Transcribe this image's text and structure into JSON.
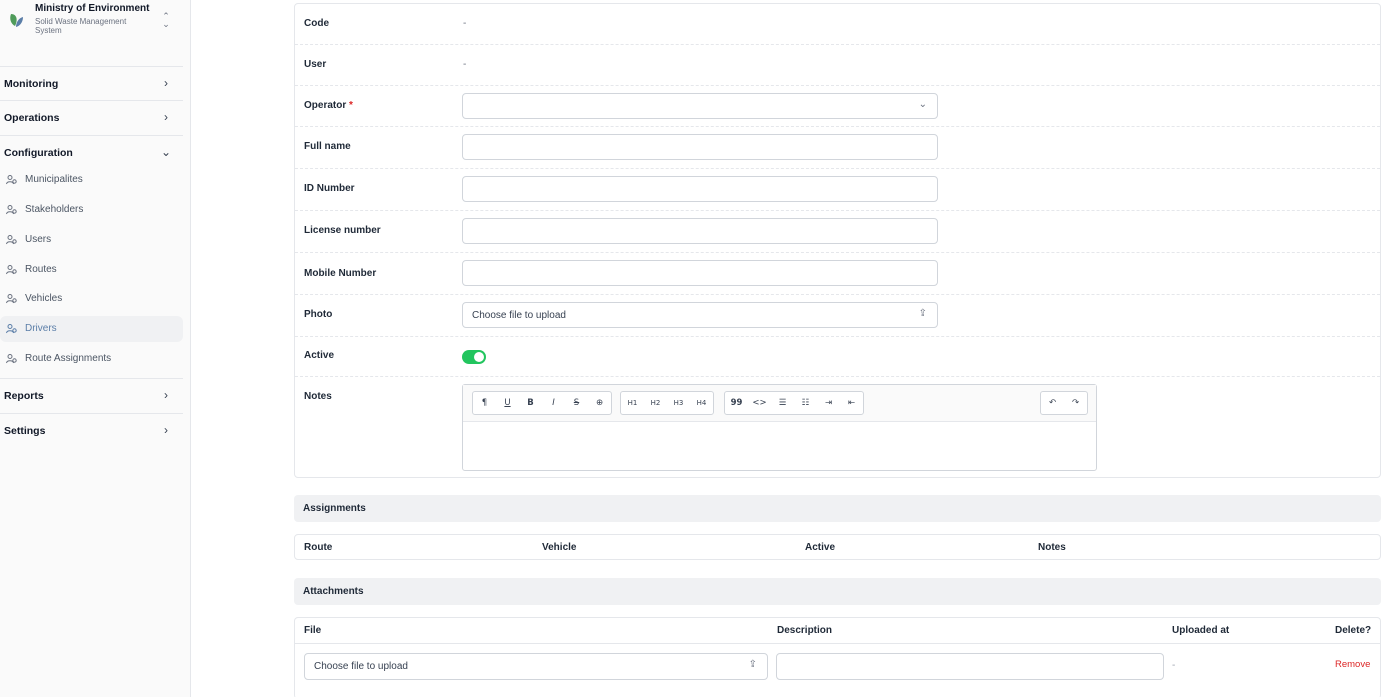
{
  "brand": {
    "title": "Ministry of Environment",
    "subtitle": "Solid Waste Management System",
    "toggle_icon": "chevron-up-down-icon",
    "logo_colors": [
      "#4f9b5a",
      "#5b7ea8"
    ]
  },
  "sidebar": {
    "monitoring": "Monitoring",
    "operations": "Operations",
    "configuration": "Configuration",
    "reports": "Reports",
    "settings": "Settings",
    "items": [
      {
        "label": "Municipalites"
      },
      {
        "label": "Stakeholders"
      },
      {
        "label": "Users"
      },
      {
        "label": "Routes"
      },
      {
        "label": "Vehicles"
      },
      {
        "label": "Drivers",
        "active": true
      },
      {
        "label": "Route Assignments"
      }
    ],
    "active_color": "#5b7ea8"
  },
  "form": {
    "code": {
      "label": "Code",
      "value": "-"
    },
    "user": {
      "label": "User",
      "value": "-"
    },
    "operator": {
      "label": "Operator",
      "required": "*",
      "value": ""
    },
    "full_name": {
      "label": "Full name",
      "value": ""
    },
    "id_number": {
      "label": "ID Number",
      "value": ""
    },
    "license_number": {
      "label": "License number",
      "value": ""
    },
    "mobile_number": {
      "label": "Mobile Number",
      "value": ""
    },
    "photo": {
      "label": "Photo",
      "placeholder": "Choose file to upload"
    },
    "active": {
      "label": "Active",
      "checked": true,
      "color": "#22c55e"
    },
    "notes": {
      "label": "Notes",
      "toolbar": [
        [
          "¶",
          "U",
          "B",
          "I",
          "S",
          "⊕"
        ],
        [
          "H1",
          "H2",
          "H3",
          "H4"
        ],
        [
          "99",
          "<>",
          "☰",
          "☷",
          "⇥",
          "⇤"
        ],
        [
          "↶",
          "↷"
        ]
      ]
    }
  },
  "assignments": {
    "title": "Assignments",
    "columns": [
      "Route",
      "Vehicle",
      "Active",
      "Notes"
    ]
  },
  "attachments": {
    "title": "Attachments",
    "columns": [
      "File",
      "Description",
      "Uploaded at",
      "Delete?"
    ],
    "row": {
      "file_placeholder": "Choose file to upload",
      "uploaded_at": "-",
      "remove": "Remove"
    },
    "remove_color": "#dc2626"
  }
}
